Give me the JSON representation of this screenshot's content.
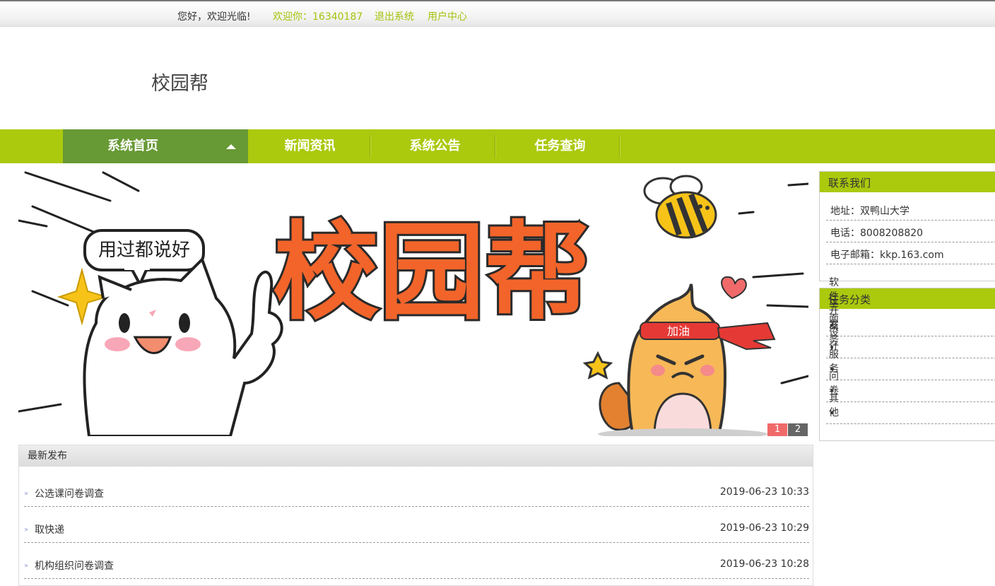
{
  "topbar": {
    "welcome": "您好，欢迎光临!",
    "user": "欢迎你：16340187",
    "logout": "退出系统",
    "user_center": "用户中心"
  },
  "header": {
    "title": "校园帮"
  },
  "nav": {
    "items": [
      {
        "label": "系统首页",
        "active": true
      },
      {
        "label": "新闻资讯"
      },
      {
        "label": "系统公告"
      },
      {
        "label": "任务查询"
      }
    ]
  },
  "banner": {
    "headline": "校园帮",
    "speech": "用过都说好",
    "headband": "加油",
    "pages": [
      "1",
      "2"
    ]
  },
  "latest": {
    "title": "最新发布",
    "items": [
      {
        "title": "公选课问卷调查",
        "date": "2019-06-23 10:33"
      },
      {
        "title": "取快递",
        "date": "2019-06-23 10:29"
      },
      {
        "title": "机构组织问卷调查",
        "date": "2019-06-23 10:28"
      }
    ]
  },
  "contact": {
    "title": "联系我们",
    "lines": [
      "地址：双鸭山大学",
      "电话：8008208820",
      "电子邮箱：kkp.163.com"
    ]
  },
  "categories": {
    "title": "任务分类",
    "items": [
      "软件开发",
      "平面设计",
      "商务服务",
      "问卷",
      "其他"
    ]
  },
  "colors": {
    "accent": "#abc90d",
    "nav_active": "#679934",
    "link": "#a7c20b"
  }
}
